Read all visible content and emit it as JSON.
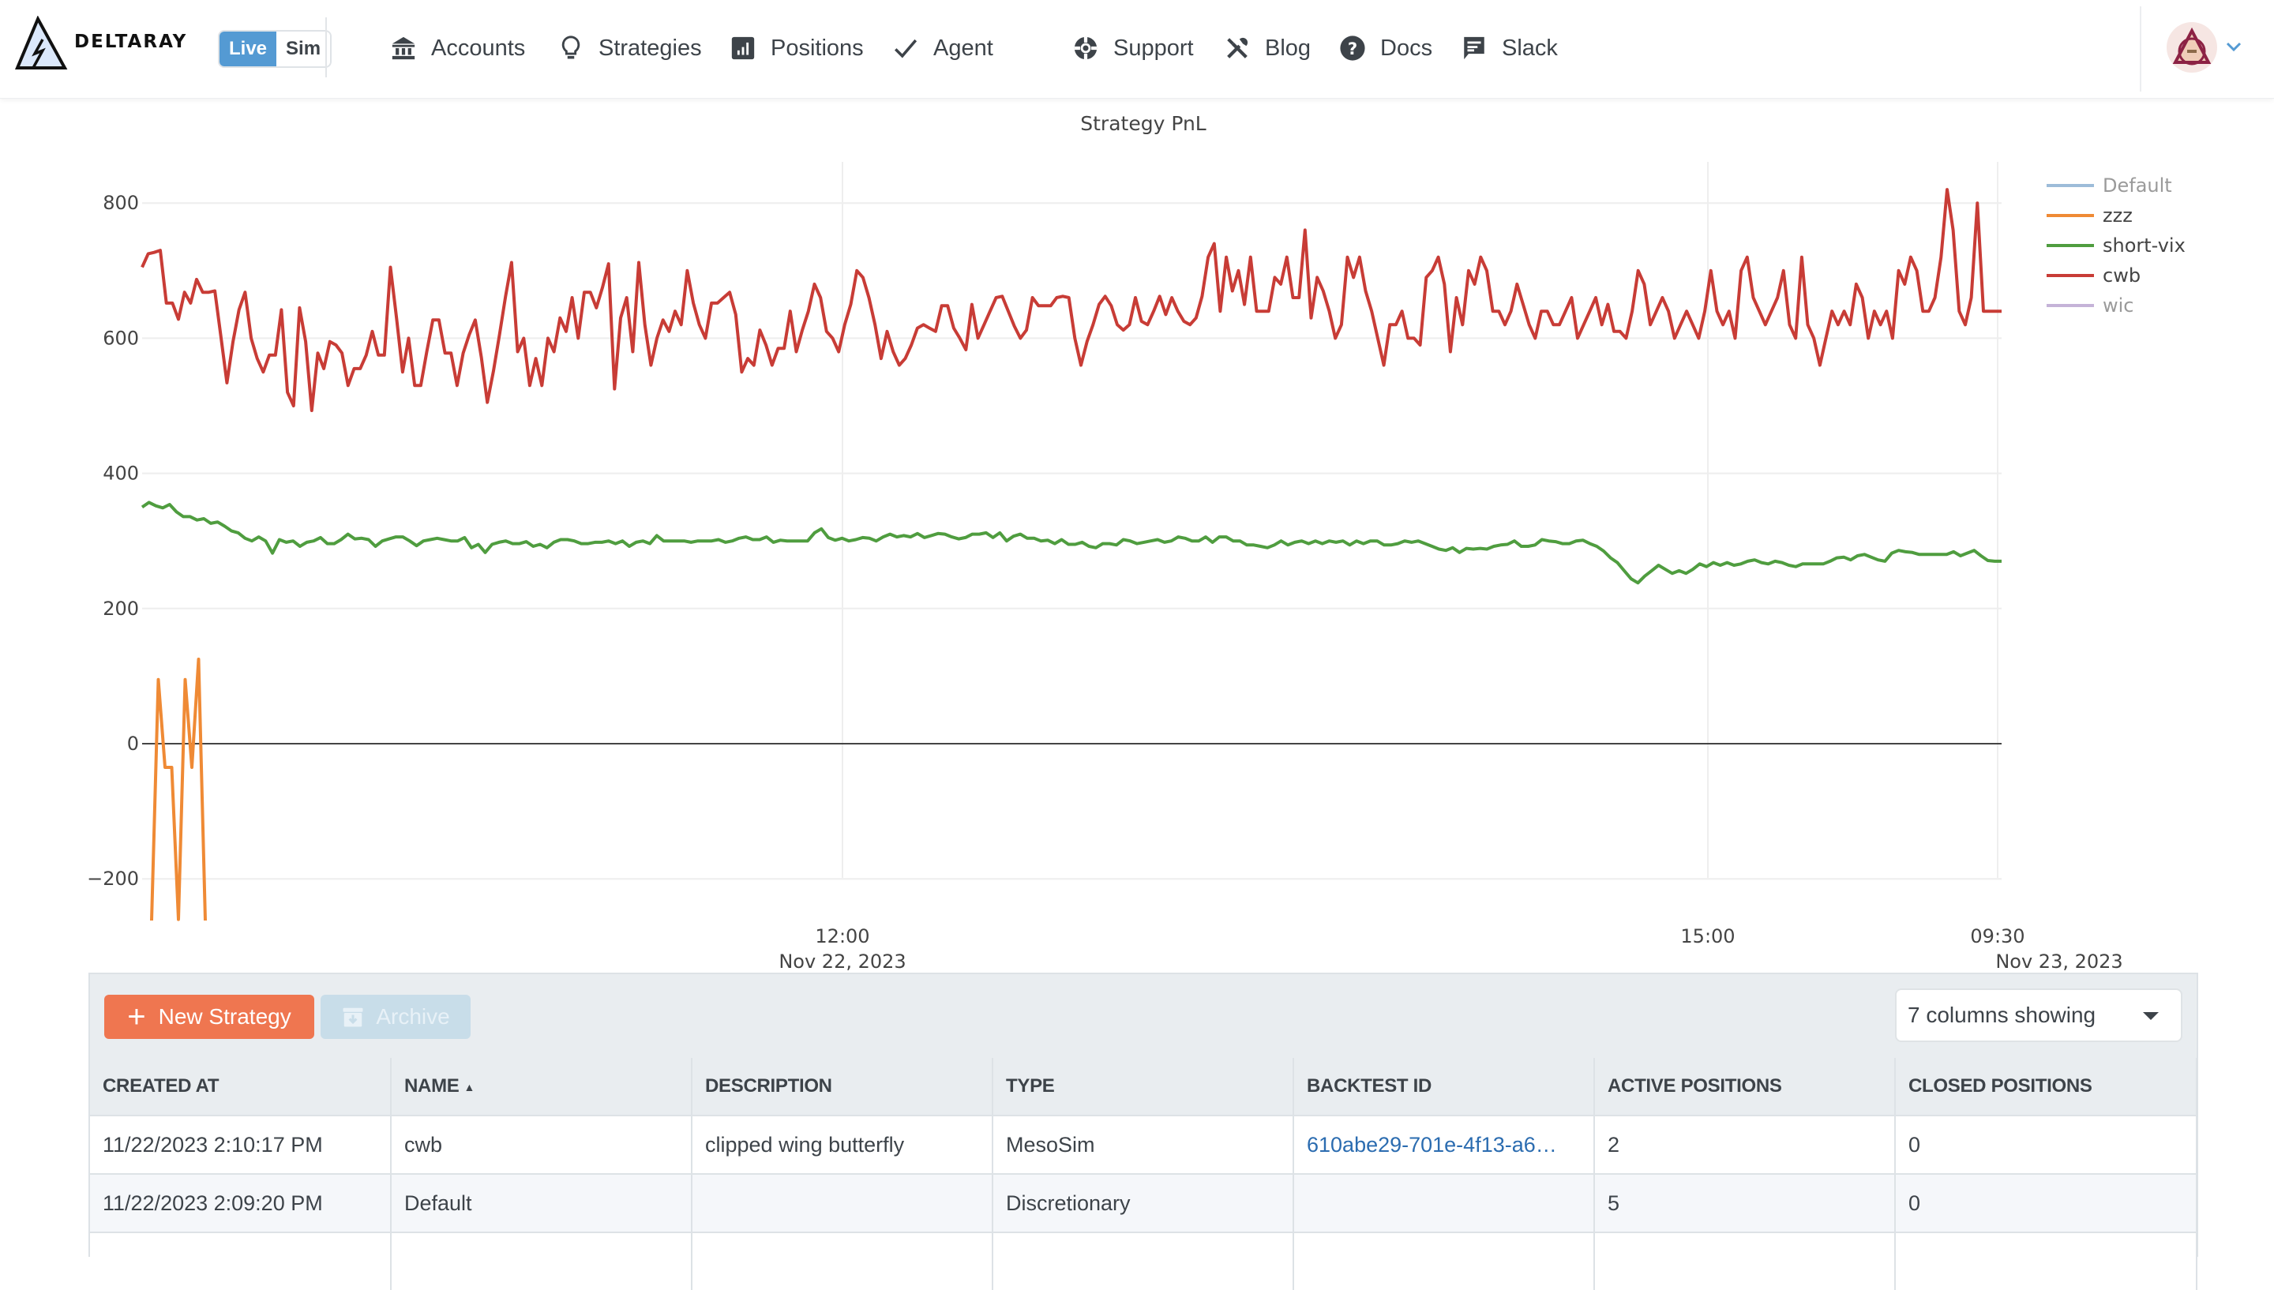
{
  "header": {
    "brand": "DELTARAY",
    "mode_toggle": {
      "live": "Live",
      "sim": "Sim",
      "active": "Live"
    },
    "nav_left": [
      {
        "label": "Accounts",
        "icon": "bank-icon"
      },
      {
        "label": "Strategies",
        "icon": "lightbulb-icon"
      },
      {
        "label": "Positions",
        "icon": "bar-chart-icon"
      },
      {
        "label": "Agent",
        "icon": "check-icon"
      }
    ],
    "nav_right": [
      {
        "label": "Support",
        "icon": "lifebuoy-icon"
      },
      {
        "label": "Blog",
        "icon": "tools-icon"
      },
      {
        "label": "Docs",
        "icon": "question-circle-icon"
      },
      {
        "label": "Slack",
        "icon": "chat-icon"
      }
    ],
    "avatar_icon": "user-avatar",
    "accent": "#549ad3"
  },
  "chart_data": {
    "type": "line",
    "title": "Strategy PnL",
    "xlabel": "",
    "ylabel": "",
    "ylim": [
      -280,
      840
    ],
    "yticks": [
      -200,
      0,
      200,
      400,
      600,
      800
    ],
    "ytick_labels": [
      "−200",
      "0",
      "200",
      "400",
      "600",
      "800"
    ],
    "xticks": [
      {
        "label": [
          "12:00",
          "Nov 22, 2023"
        ]
      },
      {
        "label": [
          "15:00",
          ""
        ]
      },
      {
        "label": [
          "09:30",
          "Nov 23, 2023"
        ]
      }
    ],
    "x_range": [
      "2023-11-22 09:34",
      "2023-11-23 09:30"
    ],
    "x_note": "non-trading hours collapsed (16:00 Nov 22 to 09:30 Nov 23)",
    "grid": true,
    "legend_position": "top-right",
    "series": [
      {
        "name": "Default",
        "color": "#9dbcd9",
        "visible": false,
        "values": []
      },
      {
        "name": "zzz",
        "color": "#ef8a35",
        "visible": true,
        "start_minute": 1,
        "values": [
          -265,
          95,
          -35,
          -35,
          -260,
          95,
          -35,
          125,
          -265
        ]
      },
      {
        "name": "short-vix",
        "color": "#4f9d3f",
        "visible": true,
        "values": [
          350,
          357,
          352,
          349,
          354,
          343,
          336,
          336,
          331,
          333,
          326,
          328,
          322,
          315,
          312,
          304,
          300,
          306,
          300,
          282,
          302,
          298,
          300,
          292,
          298,
          300,
          305,
          296,
          296,
          302,
          310,
          303,
          304,
          302,
          292,
          300,
          303,
          306,
          306,
          300,
          293,
          300,
          302,
          304,
          302,
          300,
          300,
          305,
          290,
          295,
          283,
          295,
          298,
          300,
          296,
          296,
          299,
          292,
          295,
          290,
          298,
          302,
          302,
          300,
          296,
          296,
          298,
          298,
          300,
          296,
          300,
          292,
          298,
          300,
          296,
          308,
          300,
          300,
          300,
          300,
          298,
          300,
          300,
          300,
          302,
          298,
          300,
          304,
          306,
          302,
          302,
          306,
          298,
          301,
          300,
          300,
          300,
          300,
          312,
          318,
          305,
          301,
          304,
          300,
          302,
          305,
          304,
          300,
          306,
          310,
          306,
          308,
          306,
          311,
          305,
          308,
          311,
          310,
          306,
          303,
          305,
          310,
          310,
          312,
          305,
          312,
          300,
          307,
          310,
          304,
          304,
          300,
          301,
          296,
          302,
          295,
          295,
          298,
          292,
          290,
          296,
          296,
          294,
          302,
          300,
          296,
          298,
          300,
          302,
          298,
          300,
          306,
          304,
          300,
          300,
          306,
          298,
          306,
          306,
          300,
          300,
          294,
          294,
          292,
          290,
          294,
          300,
          294,
          298,
          300,
          296,
          300,
          296,
          300,
          298,
          300,
          294,
          300,
          296,
          300,
          300,
          294,
          294,
          296,
          300,
          298,
          300,
          296,
          292,
          288,
          286,
          290,
          283,
          289,
          288,
          289,
          288,
          292,
          294,
          295,
          300,
          292,
          292,
          294,
          302,
          300,
          299,
          296,
          296,
          300,
          301,
          296,
          292,
          285,
          275,
          268,
          256,
          244,
          238,
          248,
          256,
          264,
          258,
          252,
          256,
          252,
          258,
          266,
          262,
          268,
          264,
          268,
          264,
          266,
          270,
          272,
          268,
          266,
          270,
          268,
          264,
          262,
          266,
          266,
          266,
          266,
          270,
          275,
          276,
          272,
          278,
          280,
          276,
          272,
          270,
          282,
          286,
          284,
          283,
          280,
          280,
          280,
          280,
          280,
          284,
          278,
          282,
          286,
          278,
          271,
          270,
          270
        ]
      },
      {
        "name": "cwb",
        "color": "#c83c36",
        "visible": true,
        "values": [
          705,
          725,
          727,
          730,
          652,
          652,
          628,
          668,
          652,
          687,
          668,
          668,
          670,
          603,
          534,
          595,
          642,
          668,
          600,
          570,
          550,
          575,
          575,
          642,
          520,
          500,
          645,
          595,
          493,
          578,
          555,
          595,
          590,
          578,
          530,
          555,
          555,
          575,
          610,
          575,
          575,
          705,
          630,
          550,
          600,
          530,
          530,
          580,
          627,
          627,
          578,
          578,
          530,
          578,
          605,
          627,
          572,
          505,
          551,
          605,
          662,
          712,
          580,
          600,
          530,
          570,
          530,
          600,
          580,
          630,
          610,
          660,
          600,
          668,
          668,
          645,
          675,
          710,
          525,
          630,
          660,
          580,
          712,
          620,
          560,
          600,
          627,
          610,
          640,
          620,
          700,
          652,
          620,
          600,
          652,
          652,
          660,
          668,
          635,
          550,
          570,
          560,
          612,
          590,
          560,
          585,
          585,
          640,
          580,
          612,
          640,
          680,
          660,
          610,
          600,
          580,
          620,
          650,
          700,
          690,
          660,
          620,
          570,
          610,
          580,
          560,
          570,
          590,
          615,
          620,
          615,
          610,
          648,
          648,
          615,
          600,
          583,
          650,
          600,
          620,
          640,
          660,
          662,
          640,
          618,
          600,
          612,
          660,
          648,
          648,
          648,
          660,
          662,
          660,
          600,
          560,
          595,
          620,
          650,
          662,
          648,
          620,
          612,
          620,
          660,
          625,
          620,
          640,
          662,
          635,
          660,
          640,
          625,
          620,
          630,
          662,
          720,
          740,
          640,
          720,
          670,
          700,
          650,
          720,
          640,
          640,
          640,
          690,
          680,
          720,
          660,
          660,
          760,
          630,
          690,
          670,
          640,
          600,
          620,
          720,
          690,
          720,
          670,
          640,
          600,
          560,
          620,
          620,
          640,
          600,
          600,
          590,
          690,
          700,
          720,
          680,
          580,
          660,
          620,
          700,
          680,
          720,
          700,
          640,
          640,
          620,
          640,
          680,
          650,
          620,
          600,
          640,
          640,
          620,
          620,
          640,
          660,
          600,
          620,
          640,
          660,
          620,
          650,
          610,
          610,
          600,
          640,
          700,
          680,
          620,
          640,
          660,
          640,
          600,
          620,
          640,
          620,
          600,
          640,
          700,
          640,
          620,
          640,
          600,
          700,
          720,
          660,
          640,
          620,
          640,
          660,
          700,
          620,
          600,
          720,
          620,
          600,
          560,
          600,
          640,
          620,
          640,
          620,
          680,
          660,
          600,
          640,
          620,
          640,
          600,
          700,
          680,
          720,
          700,
          640,
          640,
          660,
          720,
          820,
          760,
          640,
          620,
          660,
          800,
          640,
          640,
          640,
          640
        ]
      },
      {
        "name": "wic",
        "color": "#c5b3d8",
        "visible": false,
        "values": []
      }
    ]
  },
  "toolbar": {
    "new_strategy_label": "New Strategy",
    "archive_label": "Archive",
    "archive_disabled": true,
    "columns_select_value": "7 columns showing"
  },
  "table": {
    "columns": [
      "Created At",
      "Name",
      "Description",
      "Type",
      "Backtest ID",
      "Active Positions",
      "Closed Positions"
    ],
    "sorted_column": "Name",
    "sort_direction": "ascending",
    "rows": [
      {
        "created_at": "11/22/2023 2:10:17 PM",
        "name": "cwb",
        "description": "clipped wing butterfly",
        "type": "MesoSim",
        "backtest_id": "610abe29-701e-4f13-a6…",
        "active_positions": "2",
        "closed_positions": "0"
      },
      {
        "created_at": "11/22/2023 2:09:20 PM",
        "name": "Default",
        "description": "",
        "type": "Discretionary",
        "backtest_id": "",
        "active_positions": "5",
        "closed_positions": "0"
      }
    ]
  }
}
